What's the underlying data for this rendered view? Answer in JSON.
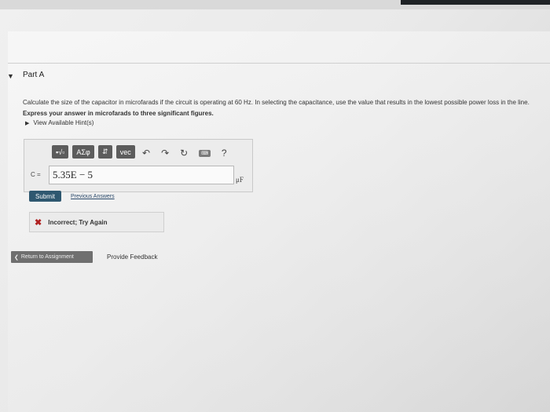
{
  "part": {
    "toggle_icon": "▼",
    "title": "Part A"
  },
  "question": {
    "text": "Calculate the size of the capacitor in microfarads if the circuit is operating at 60 Hz. In selecting the capacitance, use the value that results in the lowest possible power loss in the line.",
    "instruction": "Express your answer in microfarads to three significant figures."
  },
  "hints": {
    "arrow": "▶",
    "label": "View Available Hint(s)"
  },
  "toolbar": {
    "templates": "▪√▫",
    "greek": "ΑΣφ",
    "matrix": "⇵",
    "vec": "vec",
    "undo": "↶",
    "redo": "↷",
    "reset": "↻",
    "keyboard": "⌨",
    "help": "?"
  },
  "answer": {
    "variable": "C =",
    "value": "5.35E − 5",
    "unit": "μF"
  },
  "actions": {
    "submit": "Submit",
    "previous": "Previous Answers"
  },
  "feedback": {
    "icon": "✖",
    "text": "Incorrect; Try Again"
  },
  "footer": {
    "return_arrow": "❮",
    "return": "Return to Assignment",
    "provide": "Provide Feedback"
  },
  "colors": {
    "submit": "#2f5870",
    "incorrect": "#b02020",
    "toolbar": "#5c5c5c"
  }
}
